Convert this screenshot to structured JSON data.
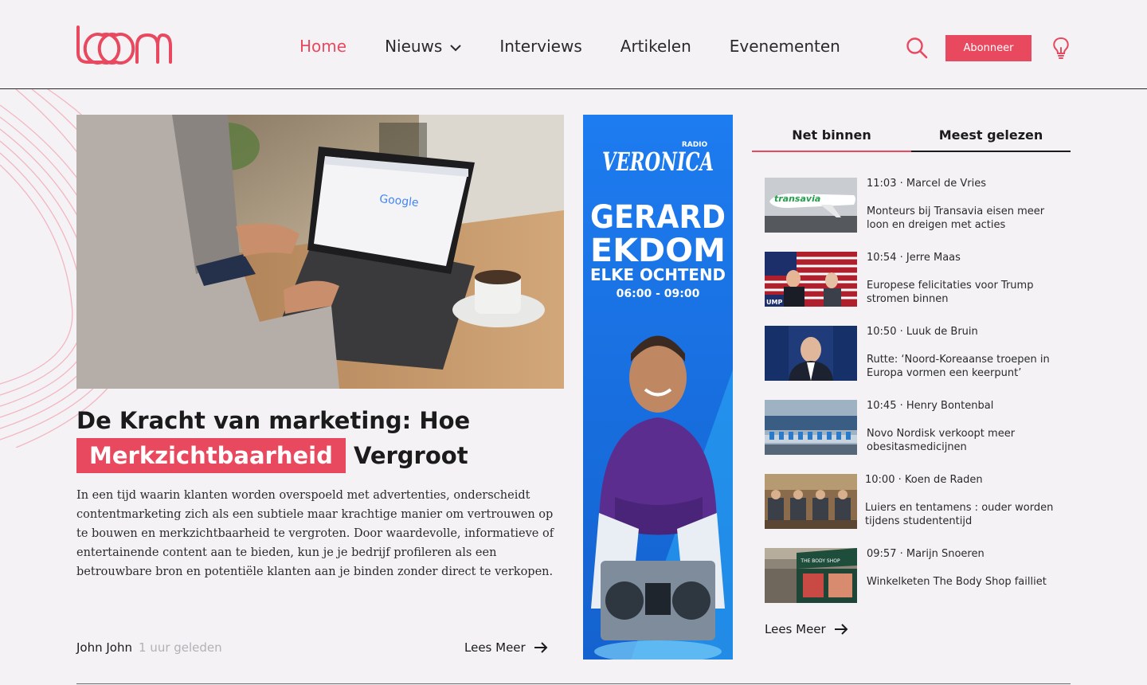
{
  "brand": {
    "logo_text": "loom",
    "accent": "#e8495f"
  },
  "nav": {
    "items": [
      {
        "label": "Home",
        "active": true
      },
      {
        "label": "Nieuws",
        "dropdown": true
      },
      {
        "label": "Interviews"
      },
      {
        "label": "Artikelen"
      },
      {
        "label": "Evenementen"
      }
    ],
    "search_icon": "search-icon",
    "subscribe_label": "Abonneer",
    "bulb_icon": "lightbulb-icon"
  },
  "featured": {
    "title_before": "De Kracht van marketing: Hoe",
    "title_highlight": "Merkzichtbaarheid",
    "title_after": "Vergroot",
    "excerpt": "In een tijd waarin klanten worden overspoeld met advertenties, onderscheidt contentmarketing zich als een subtiele maar krachtige manier om vertrouwen op te bouwen en merkzichtbaarheid te vergroten. Door waardevolle, informatieve of entertainende content aan te bieden, kun je je bedrijf profileren als een betrouwbare bron en potentiële klanten aan je binden zonder direct te verkopen.",
    "author": "John John",
    "time": "1 uur geleden",
    "read_more": "Lees Meer",
    "laptop_screen_text": "Google"
  },
  "ad": {
    "radio_label": "RADIO",
    "brand": "VERONICA",
    "line1": "GERARD",
    "line2": "EKDOM",
    "line3": "ELKE OCHTEND",
    "hours": "06:00 - 09:00"
  },
  "sidebar": {
    "tabs": [
      {
        "label": "Net binnen",
        "active": true
      },
      {
        "label": "Meest gelezen",
        "active": false
      }
    ],
    "items": [
      {
        "meta": "11:03 · Marcel de Vries",
        "headline": "Monteurs bij Transavia eisen meer loon en dreigen met acties",
        "thumb_text": "transavia"
      },
      {
        "meta": "10:54 · Jerre Maas",
        "headline": "Europese felicitaties voor Trump stromen binnen",
        "thumb_text": "UMP"
      },
      {
        "meta": "10:50 · Luuk de Bruin",
        "headline": "Rutte: ‘Noord-Koreaanse troepen in Europa vormen een keerpunt’"
      },
      {
        "meta": "10:45 · Henry Bontenbal",
        "headline": "Novo Nordisk verkoopt meer obesitasmedicijnen"
      },
      {
        "meta": "10:00 · Koen de Raden",
        "headline": "Luiers en tentamens : ouder worden tijdens studententijd"
      },
      {
        "meta": "09:57 · Marijn Snoeren",
        "headline": "Winkelketen The Body Shop failliet",
        "thumb_text": "THE BODY SHOP"
      }
    ],
    "read_more": "Lees Meer"
  }
}
